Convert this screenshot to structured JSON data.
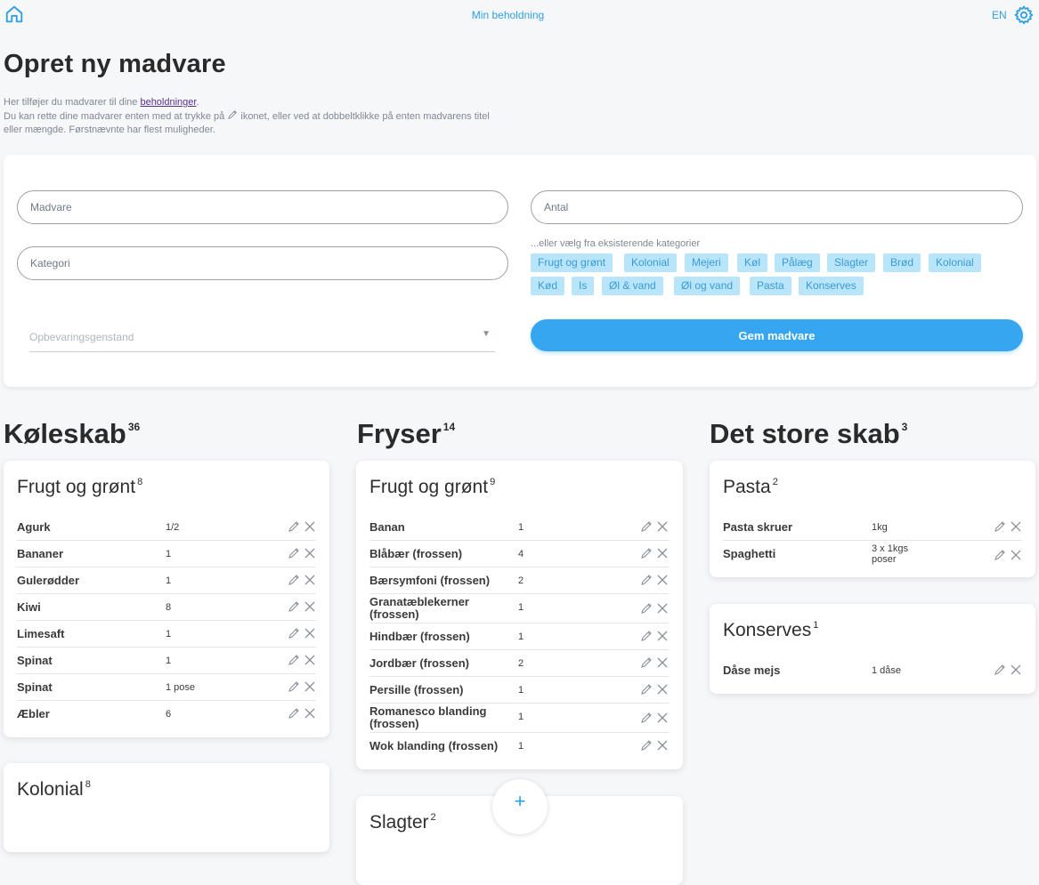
{
  "nav": {
    "title": "Min beholdning",
    "lang": "EN"
  },
  "page": {
    "title": "Opret ny madvare",
    "intro_1_pre": "Her tilføjer du madvarer til dine ",
    "intro_1_link": "beholdninger",
    "intro_1_post": ".",
    "intro_2_pre": "Du kan rette dine madvarer enten med at trykke på ",
    "intro_2_post": " ikonet, eller ved at dobbeltklikke på enten madvarens titel",
    "intro_3": "eller mængde. Førstnævnte har flest muligheder."
  },
  "form": {
    "food_placeholder": "Madvare",
    "amount_placeholder": "Antal",
    "category_placeholder": "Kategori",
    "storage_placeholder": "Opbevaringsgenstand",
    "category_hint": "...eller vælg fra eksisterende kategorier",
    "chips": [
      "Frugt og grønt",
      "Kolonial",
      "Mejeri",
      "Køl",
      "Pålæg",
      "Slagter",
      "Brød",
      "Kolonial",
      "Kød",
      "Is",
      "Øl & vand",
      "Øl og vand",
      "Pasta",
      "Konserves"
    ],
    "save_label": "Gem madvare"
  },
  "colors": {
    "accent": "#37a6f0",
    "chip_bg": "#b9e5fb",
    "chip_text": "#3a9ad6"
  },
  "columns": [
    {
      "title": "Køleskab",
      "count": "36",
      "cards": [
        {
          "title": "Frugt og grønt",
          "count": "8",
          "rows": [
            {
              "name": "Agurk",
              "qty": "1/2"
            },
            {
              "name": "Bananer",
              "qty": "1"
            },
            {
              "name": "Gulerødder",
              "qty": "1"
            },
            {
              "name": "Kiwi",
              "qty": "8"
            },
            {
              "name": "Limesaft",
              "qty": "1"
            },
            {
              "name": "Spinat",
              "qty": "1"
            },
            {
              "name": "Spinat",
              "qty": "1 pose"
            },
            {
              "name": "Æbler",
              "qty": "6"
            }
          ]
        },
        {
          "title": "Kolonial",
          "count": "8",
          "rows": []
        }
      ]
    },
    {
      "title": "Fryser",
      "count": "14",
      "cards": [
        {
          "title": "Frugt og grønt",
          "count": "9",
          "rows": [
            {
              "name": "Banan",
              "qty": "1"
            },
            {
              "name": "Blåbær (frossen)",
              "qty": "4"
            },
            {
              "name": "Bærsymfoni (frossen)",
              "qty": "2"
            },
            {
              "name": "Granatæblekerner (frossen)",
              "qty": "1"
            },
            {
              "name": "Hindbær (frossen)",
              "qty": "1"
            },
            {
              "name": "Jordbær (frossen)",
              "qty": "2"
            },
            {
              "name": "Persille (frossen)",
              "qty": "1"
            },
            {
              "name": "Romanesco blanding (frossen)",
              "qty": "1"
            },
            {
              "name": "Wok blanding (frossen)",
              "qty": "1"
            }
          ]
        },
        {
          "title": "Slagter",
          "count": "2",
          "rows": []
        }
      ]
    },
    {
      "title": "Det store skab",
      "count": "3",
      "cards": [
        {
          "title": "Pasta",
          "count": "2",
          "rows": [
            {
              "name": "Pasta skruer",
              "qty": "1kg"
            },
            {
              "name": "Spaghetti",
              "qty": "3 x 1kgs poser"
            }
          ]
        },
        {
          "title": "Konserves",
          "count": "1",
          "rows": [
            {
              "name": "Dåse mejs",
              "qty": "1 dåse"
            }
          ]
        }
      ]
    }
  ],
  "fab": {
    "icon": "plus-icon",
    "label": "+"
  }
}
